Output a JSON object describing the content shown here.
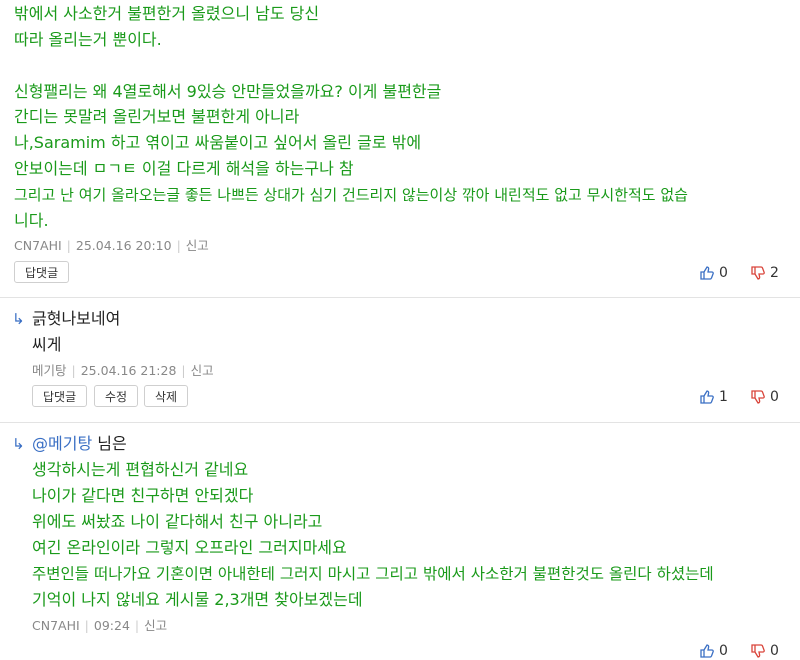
{
  "comment1": {
    "lines": [
      "밖에서 사소한거 불편한거 올렸으니 남도 당신",
      "따라 올리는거 뿐이다.",
      "",
      "신형팰리는 왜 4열로해서 9있승 안만들었을까요? 이게 불편한글",
      "간디는 못말려 올린거보면 불편한게 아니라",
      "나,Saramim 하고 엮이고 싸움붙이고 싶어서 올린 글로 밖에",
      "안보이는데 ㅁㄱㅌ 이걸 다르게 해석을 하는구나 참",
      "그리고 난 여기 올라오는글 좋든 나쁘든 상대가 심기 건드리지 않는이상 깎아 내린적도 없고 무시한적도 없습",
      "니다."
    ],
    "author": "CN7AHI",
    "date": "25.04.16",
    "time": "20:10",
    "report": "신고",
    "reply_button": "답댓글",
    "likes": "0",
    "dislikes": "2"
  },
  "comment2": {
    "line1": "긁혓나보네여",
    "line2": "씨게",
    "author": "메기탕",
    "date": "25.04.16",
    "time": "21:28",
    "report": "신고",
    "reply_button": "답댓글",
    "edit_button": "수정",
    "delete_button": "삭제",
    "likes": "1",
    "dislikes": "0"
  },
  "comment3": {
    "mention": "@메기탕",
    "mention_suffix": "님은",
    "lines": [
      "생각하시는게 편협하신거 같네요",
      "나이가 같다면 친구하면 안되겠다",
      "위에도 써놨죠 나이 같다해서 친구 아니라고",
      "여긴 온라인이라 그렇지 오프라인 그러지마세요",
      "주변인들 떠나가요 기혼이면 아내한테 그러지 마시고 그리고 밖에서 사소한거 불편한것도 올린다 하셨는데",
      "기억이 나지 않네요 게시물 2,3개면 찾아보겠는데"
    ],
    "author": "CN7AHI",
    "time": "09:24",
    "report": "신고",
    "likes": "0",
    "dislikes": "0"
  },
  "colors": {
    "text_green": "#1a9a1a",
    "mention_blue": "#3a6fc4",
    "like_blue": "#3a6fc4",
    "dislike_red": "#d9443a"
  }
}
